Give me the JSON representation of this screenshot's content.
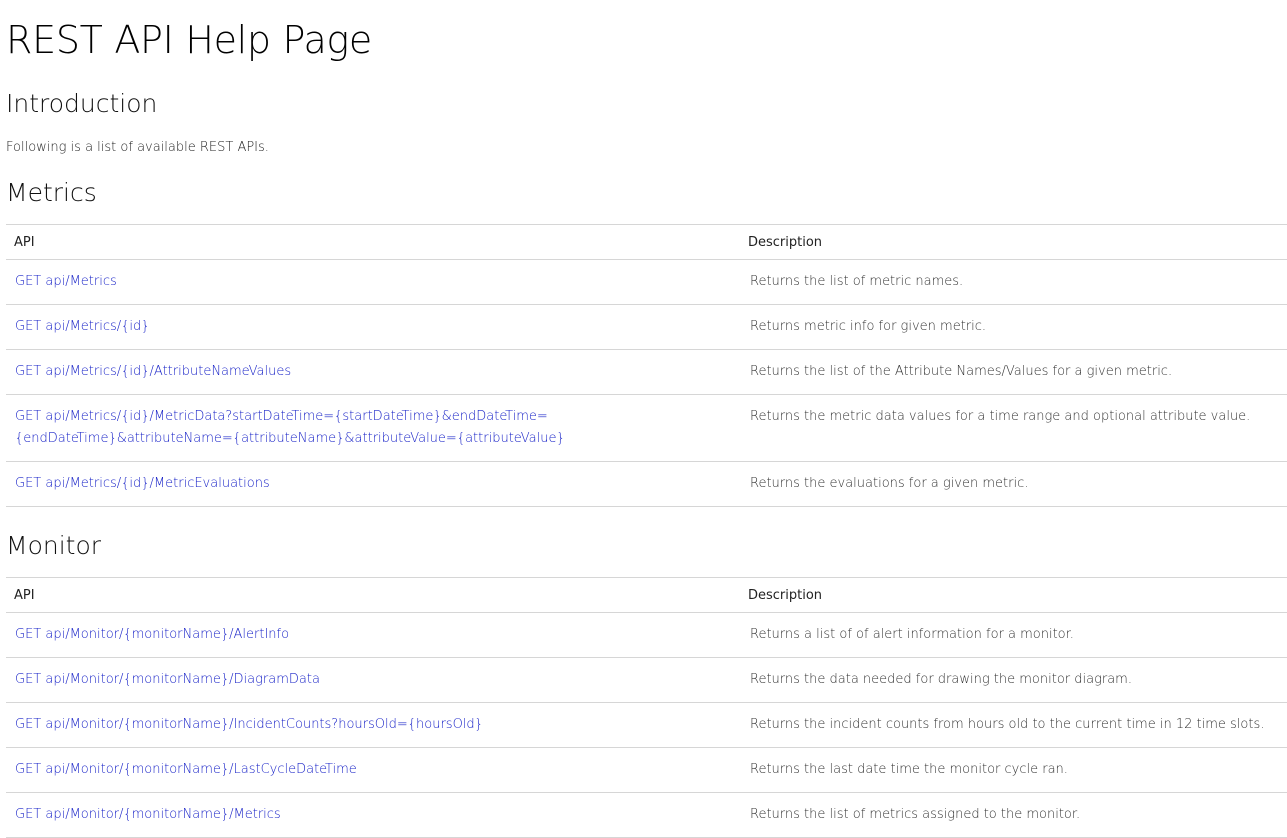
{
  "page": {
    "title": "REST API Help Page"
  },
  "introduction": {
    "heading": "Introduction",
    "text": "Following is a list of available REST APIs."
  },
  "metrics": {
    "heading": "Metrics",
    "columns": {
      "api": "API",
      "description": "Description"
    },
    "rows": [
      {
        "api": "GET api/Metrics",
        "description": "Returns the list of metric names."
      },
      {
        "api": "GET api/Metrics/{id}",
        "description": "Returns metric info for given metric."
      },
      {
        "api": "GET api/Metrics/{id}/AttributeNameValues",
        "description": "Returns the list of the Attribute Names/Values for a given metric."
      },
      {
        "api_line1": "GET api/Metrics/{id}/MetricData?startDateTime={startDateTime}&endDateTime=",
        "api_line2": "{endDateTime}&attributeName={attributeName}&attributeValue={attributeValue}",
        "description": "Returns the metric data values for a time range and optional attribute value."
      },
      {
        "api": "GET api/Metrics/{id}/MetricEvaluations",
        "description": "Returns the evaluations for a given metric."
      }
    ]
  },
  "monitor": {
    "heading": "Monitor",
    "columns": {
      "api": "API",
      "description": "Description"
    },
    "rows": [
      {
        "api": "GET api/Monitor/{monitorName}/AlertInfo",
        "description": "Returns a list of of alert information for a monitor."
      },
      {
        "api": "GET api/Monitor/{monitorName}/DiagramData",
        "description": "Returns the data needed for drawing the monitor diagram."
      },
      {
        "api": "GET api/Monitor/{monitorName}/IncidentCounts?hoursOld={hoursOld}",
        "description": "Returns the incident counts from hours old to the current time in 12 time slots."
      },
      {
        "api": "GET api/Monitor/{monitorName}/LastCycleDateTime",
        "description": "Returns the last date time the monitor cycle ran."
      },
      {
        "api": "GET api/Monitor/{monitorName}/Metrics",
        "description": "Returns the list of metrics assigned to the monitor."
      }
    ]
  },
  "colors": {
    "link": "#1a24c8",
    "border": "#d6d6d6",
    "text": "#333333"
  }
}
